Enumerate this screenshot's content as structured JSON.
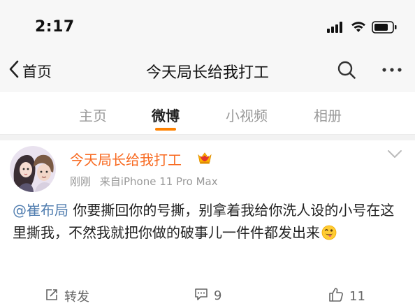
{
  "status_bar": {
    "time": "2:17",
    "icons": [
      "signal-icon",
      "wifi-icon",
      "battery-icon"
    ]
  },
  "nav": {
    "back_label": "首页",
    "title": "今天局长给我打工",
    "actions": [
      "search-icon",
      "more-icon"
    ]
  },
  "tabs": [
    {
      "label": "主页",
      "active": false
    },
    {
      "label": "微博",
      "active": true
    },
    {
      "label": "小视频",
      "active": false
    },
    {
      "label": "相册",
      "active": false
    }
  ],
  "post": {
    "author": "今天局长给我打工",
    "author_badge": "crown-badge-icon",
    "time": "刚刚",
    "source": "来自iPhone 11 Pro Max",
    "mention": "@崔布局",
    "text": " 你要撕回你的号撕，别拿着我给你洗人设的小号在这里撕我，不然我就把你做的破事儿一件件都发出来",
    "emoji": "grinning-tongue-emoji",
    "actions": {
      "repost_label": "转发",
      "comment_count": "9",
      "like_count": "11"
    }
  },
  "colors": {
    "accent": "#ff8200",
    "author_name": "#f86a21",
    "mention": "#507daf",
    "muted": "#999999"
  }
}
